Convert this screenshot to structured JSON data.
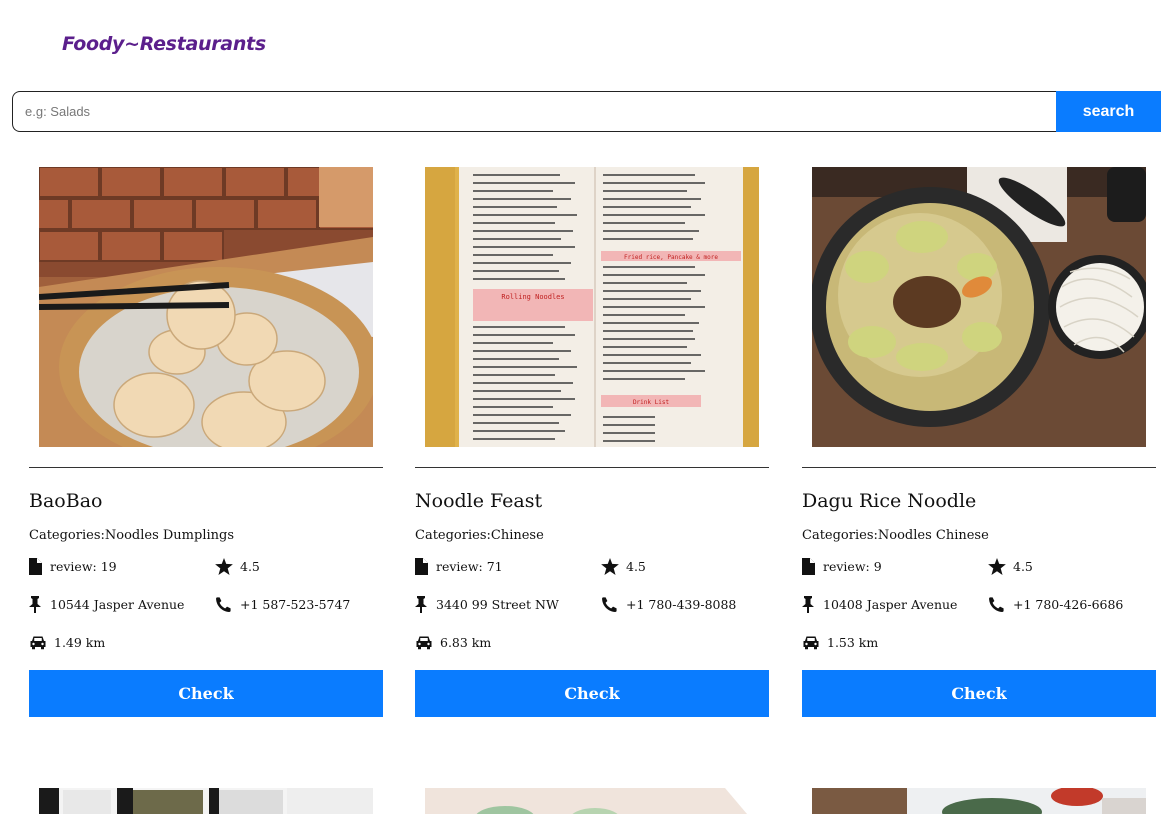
{
  "app": {
    "logo": "Foody~Restaurants"
  },
  "search": {
    "placeholder": "e.g: Salads",
    "button_label": "search"
  },
  "restaurants": [
    {
      "name": "BaoBao",
      "categories": "Categories:Noodles  Dumplings",
      "reviews": "review: 19",
      "rating": "4.5",
      "address": "10544 Jasper Avenue",
      "phone": "+1 587-523-5747",
      "distance": "1.49 km",
      "button_label": "Check"
    },
    {
      "name": "Noodle Feast",
      "categories": "Categories:Chinese",
      "reviews": "review: 71",
      "rating": "4.5",
      "address": "3440 99 Street NW",
      "phone": "+1 780-439-8088",
      "distance": "6.83 km",
      "button_label": "Check"
    },
    {
      "name": "Dagu Rice Noodle",
      "categories": "Categories:Noodles  Chinese",
      "reviews": "review: 9",
      "rating": "4.5",
      "address": "10408 Jasper Avenue",
      "phone": "+1 780-426-6686",
      "distance": "1.53 km",
      "button_label": "Check"
    }
  ],
  "menu_image_text": {
    "roll_header": "Rolling Noodles",
    "fried_header": "Fried rice, Pancake & more",
    "drink_header": "Drink List"
  },
  "icons": {
    "reviews": "document-icon",
    "rating": "star-icon",
    "address": "pin-icon",
    "phone": "phone-icon",
    "distance": "car-icon"
  },
  "colors": {
    "brand": "#5b1f8c",
    "accent": "#0a7cff"
  }
}
